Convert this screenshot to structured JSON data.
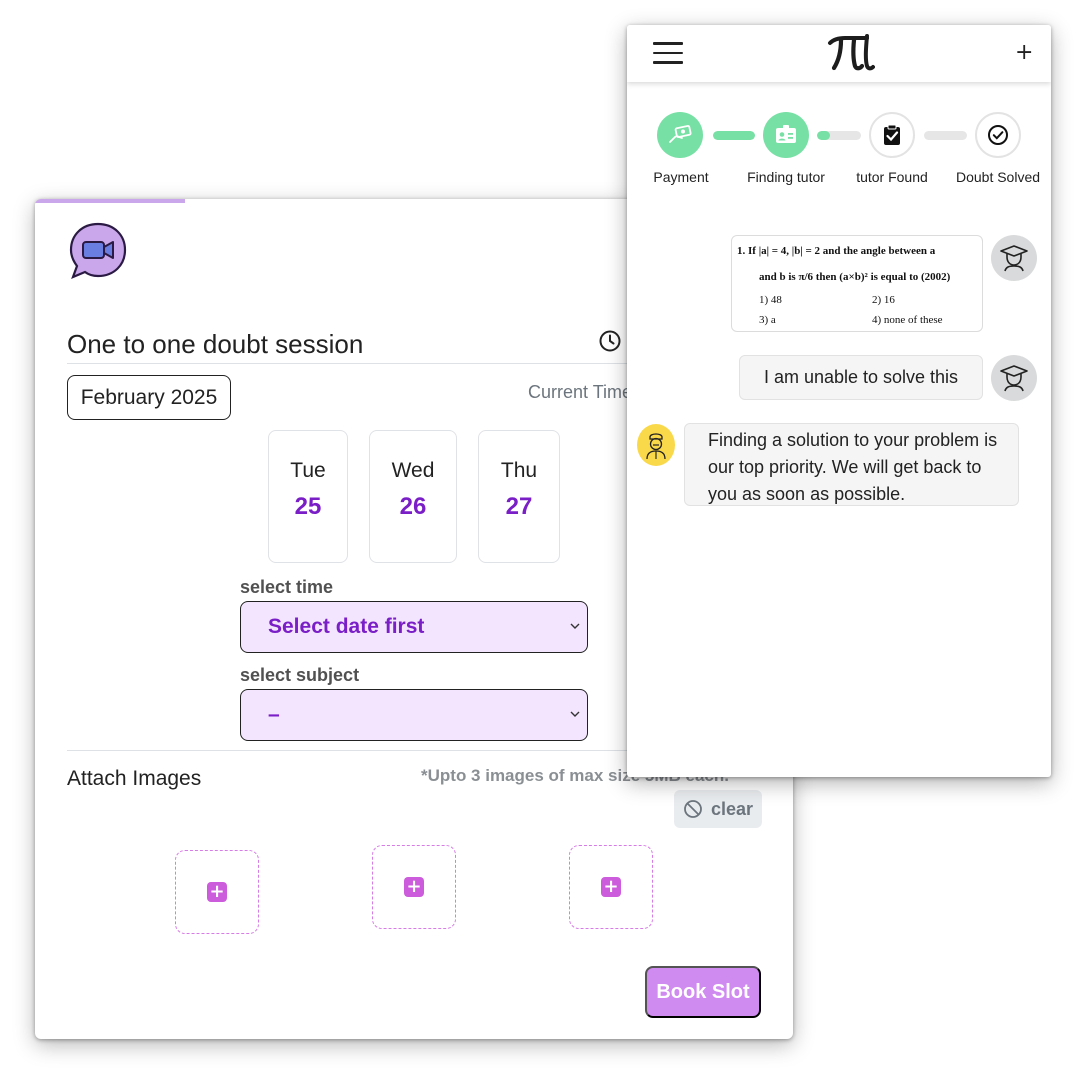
{
  "booking": {
    "title": "One to one doubt session",
    "month_label": "February 2025",
    "current_time_label": "Current Time",
    "days": [
      {
        "name": "Tue",
        "num": "25"
      },
      {
        "name": "Wed",
        "num": "26"
      },
      {
        "name": "Thu",
        "num": "27"
      }
    ],
    "time_label": "select time",
    "time_value": "Select date first",
    "subject_label": "select subject",
    "subject_value": "–",
    "attach_title": "Attach Images",
    "attach_note": "*Upto 3 images of max size 5MB each.",
    "clear_label": "clear",
    "book_label": "Book Slot",
    "icons": {
      "session": "video-camera-icon",
      "clock": "clock-icon",
      "clear": "ban-icon",
      "add": "plus-square-icon"
    },
    "colors": {
      "accent": "#7a1fc7",
      "select_bg": "#f3e5fd",
      "book_button": "#d08bf1",
      "slot_border": "#d77be6",
      "badge_bg": "#c9a7ea",
      "camera": "#6a7de0"
    }
  },
  "phone": {
    "logo_text": "πl",
    "nav_add": "+",
    "steps": [
      {
        "label": "Payment",
        "state": "done",
        "icon": "payment-icon"
      },
      {
        "label": "Finding tutor",
        "state": "done",
        "icon": "id-card-icon"
      },
      {
        "label": "tutor Found",
        "state": "todo",
        "icon": "clipboard-check-icon"
      },
      {
        "label": "Doubt Solved",
        "state": "todo",
        "icon": "check-circle-icon"
      }
    ],
    "step_progress": [
      1.0,
      0.3,
      0.0
    ],
    "question": {
      "line1": "1.   If |a| = 4, |b| = 2 and the angle between  a",
      "line2": "and  b is π/6 then (a×b)² is equal to   (2002)",
      "opt1": "1) 48",
      "opt2": "2) 16",
      "opt3": "3) a",
      "opt4": "4) none of these"
    },
    "user_message": "I am unable to solve this",
    "bot_message": "Finding a solution to your problem is our top priority. We will get back to you as soon as possible.",
    "colors": {
      "step_done": "#77e0a4",
      "bot_avatar": "#f9d84a",
      "user_avatar": "#d9dadb"
    }
  }
}
